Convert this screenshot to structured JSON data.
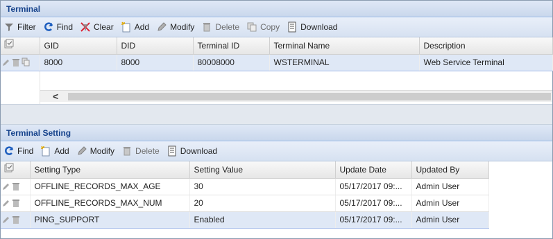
{
  "terminal": {
    "title": "Terminal",
    "toolbar": [
      {
        "label": "Filter",
        "icon": "filter-icon",
        "enabled": true
      },
      {
        "label": "Find",
        "icon": "find-icon",
        "enabled": true
      },
      {
        "label": "Clear",
        "icon": "clear-icon",
        "enabled": true
      },
      {
        "label": "Add",
        "icon": "add-icon",
        "enabled": true
      },
      {
        "label": "Modify",
        "icon": "modify-icon",
        "enabled": true
      },
      {
        "label": "Delete",
        "icon": "delete-icon",
        "enabled": false
      },
      {
        "label": "Copy",
        "icon": "copy-icon",
        "enabled": false
      },
      {
        "label": "Download",
        "icon": "download-icon",
        "enabled": true
      }
    ],
    "columns": [
      "GID",
      "DID",
      "Terminal ID",
      "Terminal Name",
      "Description"
    ],
    "rows": [
      {
        "gid": "8000",
        "did": "8000",
        "terminal_id": "80008000",
        "terminal_name": "WSTERMINAL",
        "description": "Web Service Terminal"
      }
    ],
    "scroll_left_glyph": "<"
  },
  "terminal_setting": {
    "title": "Terminal Setting",
    "toolbar": [
      {
        "label": "Find",
        "icon": "find-icon",
        "enabled": true
      },
      {
        "label": "Add",
        "icon": "add-icon",
        "enabled": true
      },
      {
        "label": "Modify",
        "icon": "modify-icon",
        "enabled": true
      },
      {
        "label": "Delete",
        "icon": "delete-icon",
        "enabled": false
      },
      {
        "label": "Download",
        "icon": "download-icon",
        "enabled": true
      }
    ],
    "columns": [
      "Setting Type",
      "Setting Value",
      "Update Date",
      "Updated By"
    ],
    "rows": [
      {
        "setting_type": "OFFLINE_RECORDS_MAX_AGE",
        "setting_value": "30",
        "update_date": "05/17/2017 09:...",
        "updated_by": "Admin User"
      },
      {
        "setting_type": "OFFLINE_RECORDS_MAX_NUM",
        "setting_value": "20",
        "update_date": "05/17/2017 09:...",
        "updated_by": "Admin User"
      },
      {
        "setting_type": "PING_SUPPORT",
        "setting_value": "Enabled",
        "update_date": "05/17/2017 09:...",
        "updated_by": "Admin User"
      }
    ]
  },
  "colors": {
    "header_text": "#15428b",
    "selected_row": "#dfe8f6",
    "panel_border": "#99bbe8"
  }
}
